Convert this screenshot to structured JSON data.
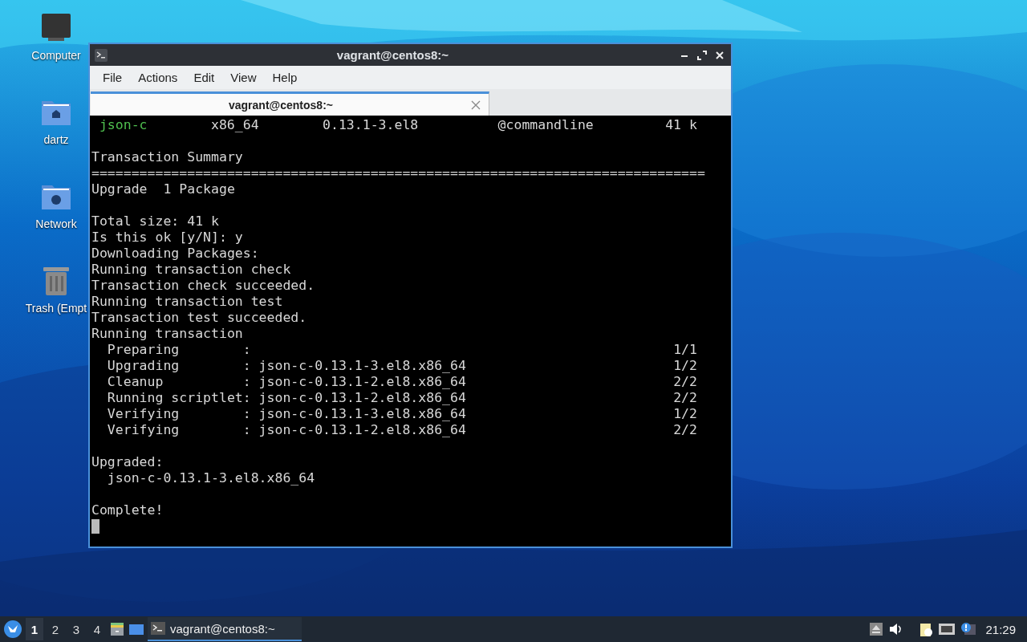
{
  "desktop_icons": [
    {
      "kind": "computer",
      "label": "Computer"
    },
    {
      "kind": "home",
      "label": "dartz"
    },
    {
      "kind": "network",
      "label": "Network"
    },
    {
      "kind": "trash",
      "label": "Trash (Empt"
    }
  ],
  "window": {
    "title": "vagrant@centos8:~",
    "menu": [
      "File",
      "Actions",
      "Edit",
      "View",
      "Help"
    ],
    "tabs": [
      {
        "label": "vagrant@centos8:~",
        "selected": true
      }
    ],
    "package_row": {
      "name": "json-c",
      "arch": "x86_64",
      "version": "0.13.1-3.el8",
      "repo": "@commandline",
      "size": "41 k"
    },
    "output_blocks": [
      [
        "Transaction Summary",
        "=============================================================================",
        "Upgrade  1 Package"
      ],
      [
        "Total size: 41 k",
        "Is this ok [y/N]: y",
        "Downloading Packages:",
        "Running transaction check",
        "Transaction check succeeded.",
        "Running transaction test",
        "Transaction test succeeded.",
        "Running transaction",
        "  Preparing        :                                                     1/1",
        "  Upgrading        : json-c-0.13.1-3.el8.x86_64                          1/2",
        "  Cleanup          : json-c-0.13.1-2.el8.x86_64                          2/2",
        "  Running scriptlet: json-c-0.13.1-2.el8.x86_64                          2/2",
        "  Verifying        : json-c-0.13.1-3.el8.x86_64                          1/2",
        "  Verifying        : json-c-0.13.1-2.el8.x86_64                          2/2"
      ],
      [
        "Upgraded:",
        "  json-c-0.13.1-3.el8.x86_64"
      ],
      [
        "Complete!"
      ]
    ]
  },
  "taskbar": {
    "workspaces": [
      {
        "label": "1",
        "selected": true
      },
      {
        "label": "2",
        "selected": false
      },
      {
        "label": "3",
        "selected": false
      },
      {
        "label": "4",
        "selected": false
      }
    ],
    "tasks": [
      {
        "label": "vagrant@centos8:~",
        "selected": true
      }
    ],
    "clock": "21:29"
  }
}
